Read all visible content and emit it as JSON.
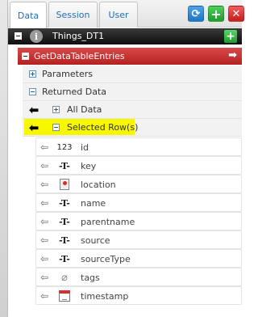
{
  "tabs": {
    "data": "Data",
    "session": "Session",
    "user": "User"
  },
  "thing": {
    "title": "Things_DT1"
  },
  "service": {
    "title": "GetDataTableEntries"
  },
  "tree": {
    "parameters": "Parameters",
    "returned_data": "Returned Data",
    "all_data": "All Data",
    "selected_rows": "Selected Row(s)"
  },
  "fields": [
    {
      "name": "id",
      "type_icon": "number-icon",
      "type_glyph": "123"
    },
    {
      "name": "key",
      "type_icon": "string-icon",
      "type_glyph": "-T-"
    },
    {
      "name": "location",
      "type_icon": "location-icon",
      "type_glyph": ""
    },
    {
      "name": "name",
      "type_icon": "string-icon",
      "type_glyph": "-T-"
    },
    {
      "name": "parentname",
      "type_icon": "string-icon",
      "type_glyph": "-T-"
    },
    {
      "name": "source",
      "type_icon": "string-icon",
      "type_glyph": "-T-"
    },
    {
      "name": "sourceType",
      "type_icon": "string-icon",
      "type_glyph": "-T-"
    },
    {
      "name": "tags",
      "type_icon": "tags-icon",
      "type_glyph": "⌀"
    },
    {
      "name": "timestamp",
      "type_icon": "datetime-icon",
      "type_glyph": ""
    }
  ],
  "colors": {
    "service_bar": "#c62f2f",
    "highlight": "#f7f700",
    "thing_bar": "#1a1a1a"
  }
}
